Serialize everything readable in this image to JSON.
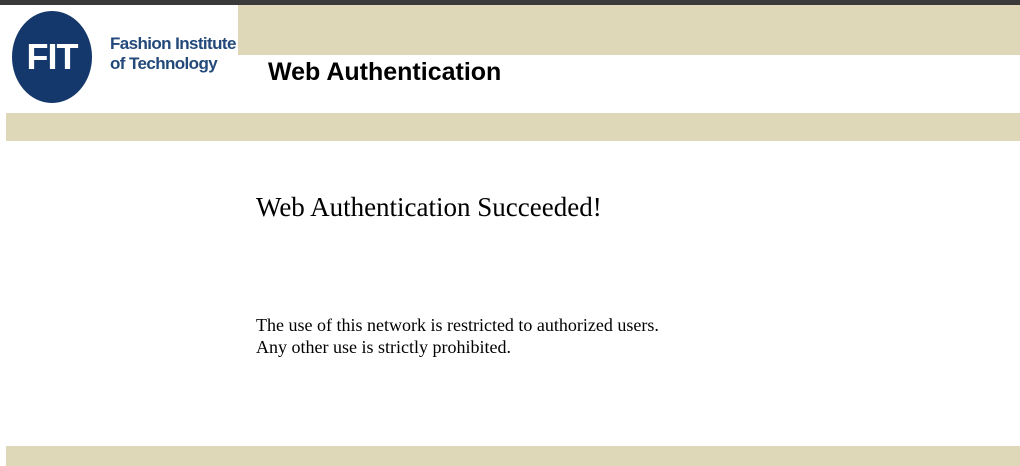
{
  "header": {
    "logo": {
      "mark": "FIT",
      "name_line1": "Fashion Institute",
      "name_line2": "of Technology"
    },
    "title": "Web Authentication"
  },
  "main": {
    "message": "Web Authentication Succeeded!",
    "notice_line1": "The use of this network is restricted to authorized users.",
    "notice_line2": "Any other use is strictly prohibited."
  },
  "colors": {
    "band": "#ded8b8",
    "logo_blue": "#14386b",
    "logo_text_blue": "#23497a"
  }
}
